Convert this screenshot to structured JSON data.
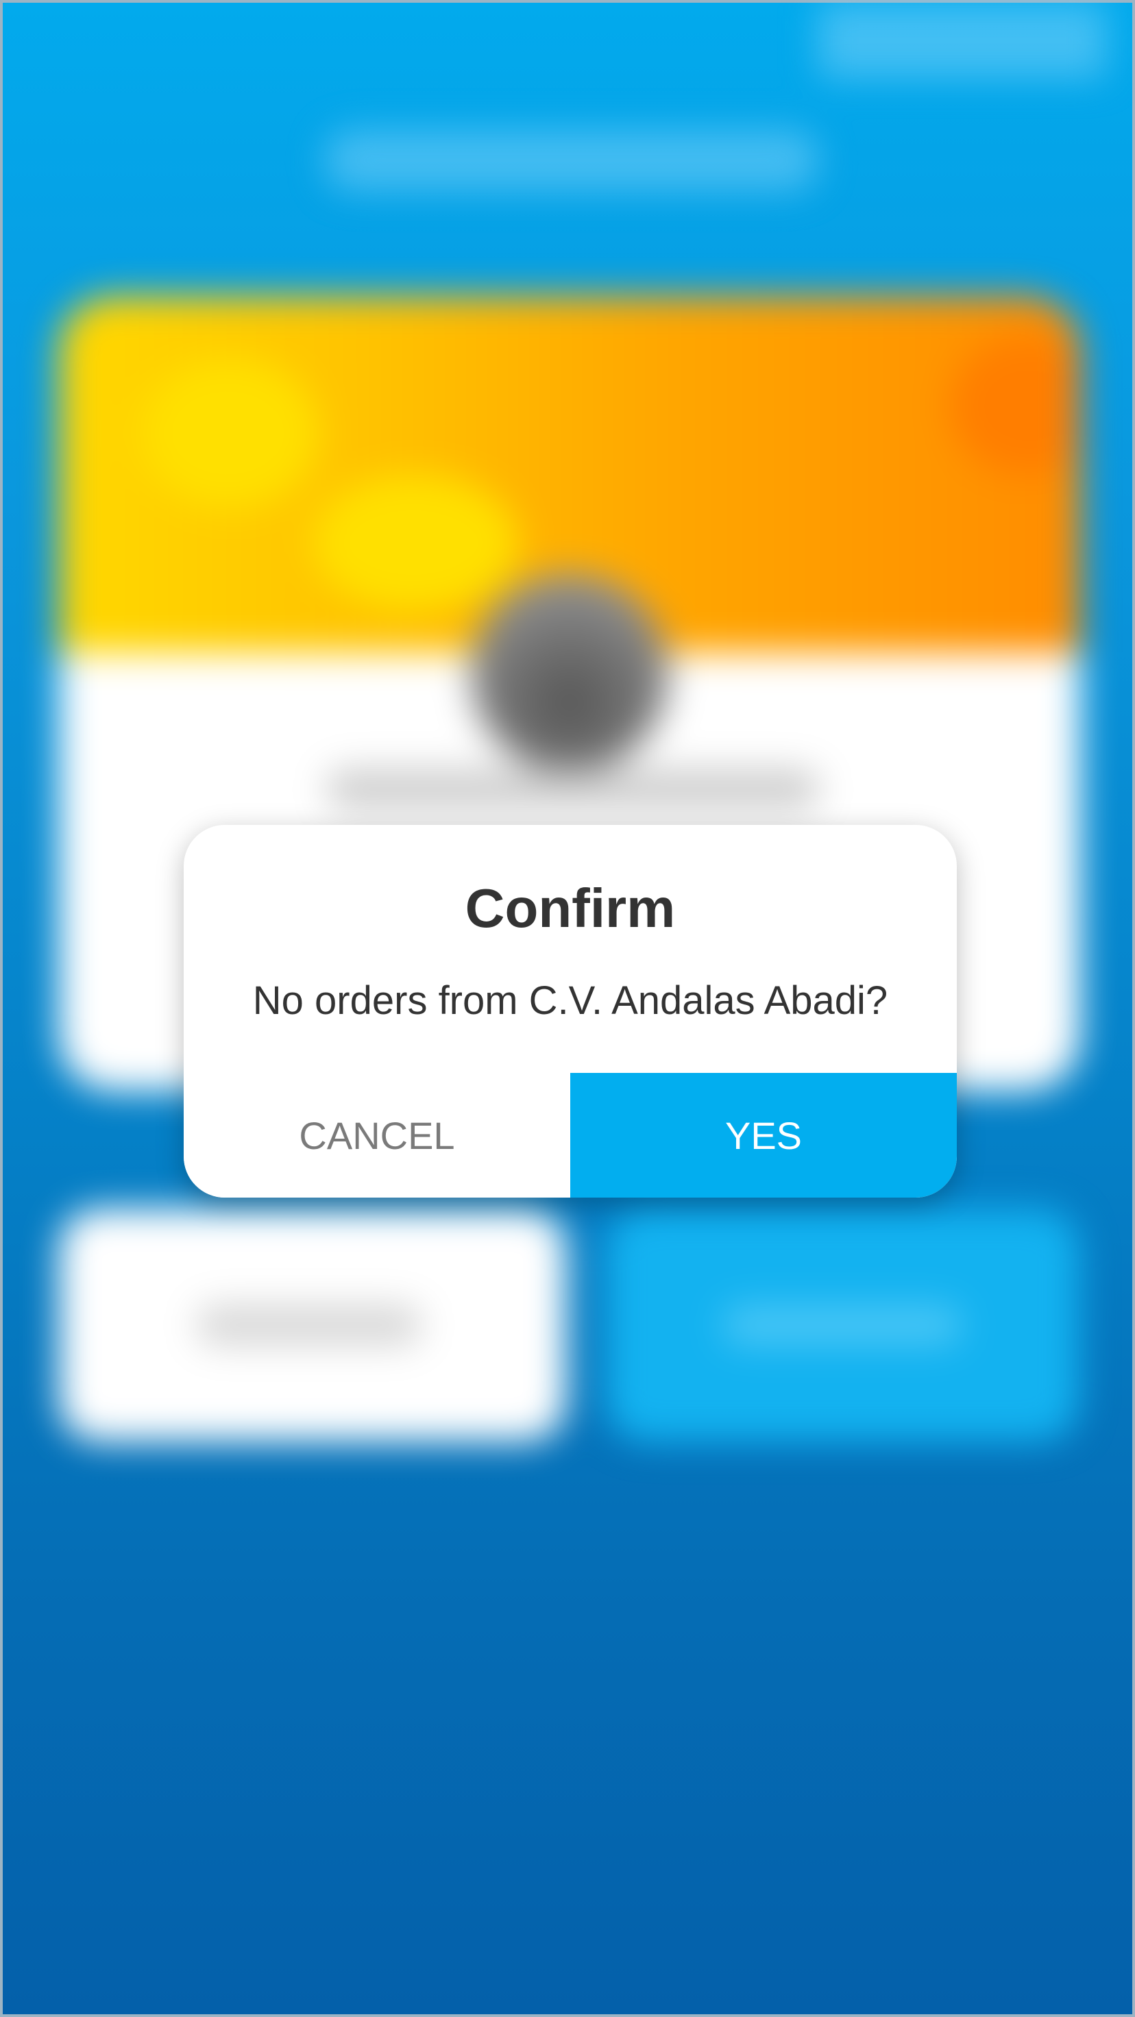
{
  "dialog": {
    "title": "Confirm",
    "message": "No orders from C.V. Andalas Abadi?",
    "cancel_label": "CANCEL",
    "confirm_label": "YES"
  },
  "colors": {
    "accent": "#02aeef",
    "background_top": "#02aaed",
    "background_bottom": "#0460aa",
    "card_header_start": "#ffd800",
    "card_header_end": "#ff8c00"
  }
}
